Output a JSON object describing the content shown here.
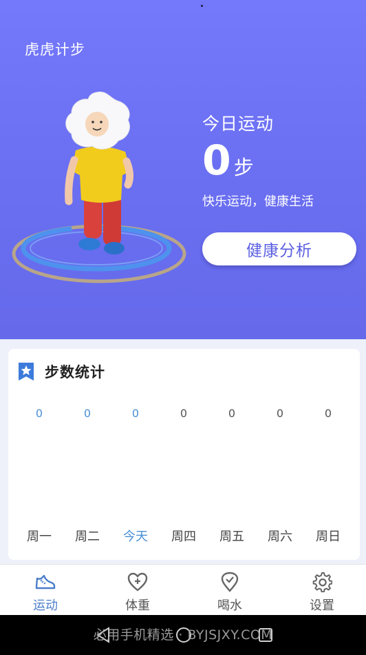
{
  "app": {
    "title": "虎虎计步"
  },
  "today": {
    "label": "今日运动",
    "steps": "0",
    "unit": "步",
    "motto": "快乐运动，健康生活",
    "analysis_button": "健康分析"
  },
  "stats": {
    "title": "步数统计",
    "icon": "star-badge-icon",
    "accent": "#4a8fd6",
    "days": [
      {
        "label": "周一",
        "value": "0",
        "state": "past"
      },
      {
        "label": "周二",
        "value": "0",
        "state": "past"
      },
      {
        "label": "今天",
        "value": "0",
        "state": "today"
      },
      {
        "label": "周四",
        "value": "0",
        "state": "future"
      },
      {
        "label": "周五",
        "value": "0",
        "state": "future"
      },
      {
        "label": "周六",
        "value": "0",
        "state": "future"
      },
      {
        "label": "周日",
        "value": "0",
        "state": "future"
      }
    ]
  },
  "tabs": [
    {
      "label": "运动",
      "icon": "sneaker-icon",
      "active": true
    },
    {
      "label": "体重",
      "icon": "heart-plus-icon",
      "active": false
    },
    {
      "label": "喝水",
      "icon": "location-check-icon",
      "active": false
    },
    {
      "label": "设置",
      "icon": "gear-icon",
      "active": false
    }
  ],
  "system_nav": {
    "watermark": "必用手机精选 · BYJSJXY.COM",
    "buttons": [
      "back-icon",
      "home-icon",
      "recents-icon"
    ]
  },
  "colors": {
    "hero_gradient_top": "#7478fb",
    "hero_gradient_bottom": "#6569ea",
    "button_text": "#5b5fe0",
    "tab_active": "#4a7ec9"
  }
}
